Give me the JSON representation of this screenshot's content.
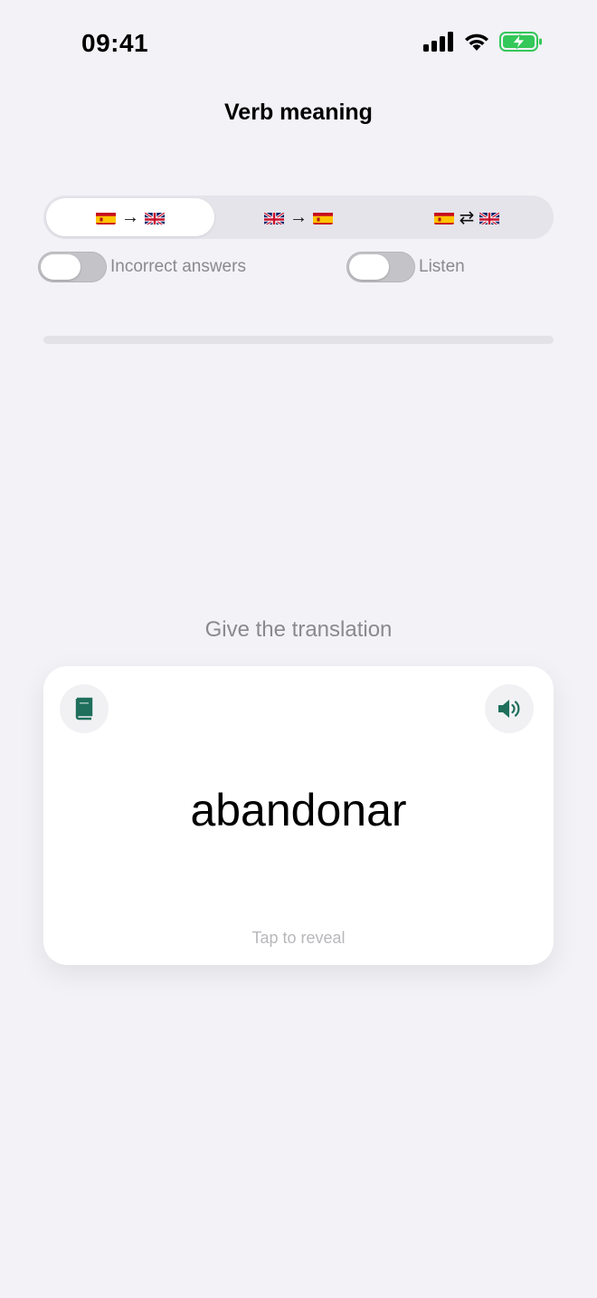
{
  "status_bar": {
    "time": "09:41"
  },
  "nav": {
    "title": "Verb meaning"
  },
  "direction_segments": [
    {
      "from": "es",
      "symbol": "→",
      "to": "gb",
      "selected": true
    },
    {
      "from": "gb",
      "symbol": "→",
      "to": "es",
      "selected": false
    },
    {
      "from": "es",
      "symbol": "⇄",
      "to": "gb",
      "selected": false
    }
  ],
  "toggles": {
    "incorrect": {
      "label": "Incorrect answers",
      "on": false
    },
    "listen": {
      "label": "Listen",
      "on": false
    }
  },
  "progress": {
    "fraction": 0
  },
  "prompt": "Give the translation",
  "card": {
    "word": "abandonar",
    "reveal_hint": "Tap to reveal",
    "left_icon": "book-icon",
    "right_icon": "speaker-icon"
  },
  "colors": {
    "accent": "#1f6f5c",
    "battery": "#34c759"
  }
}
